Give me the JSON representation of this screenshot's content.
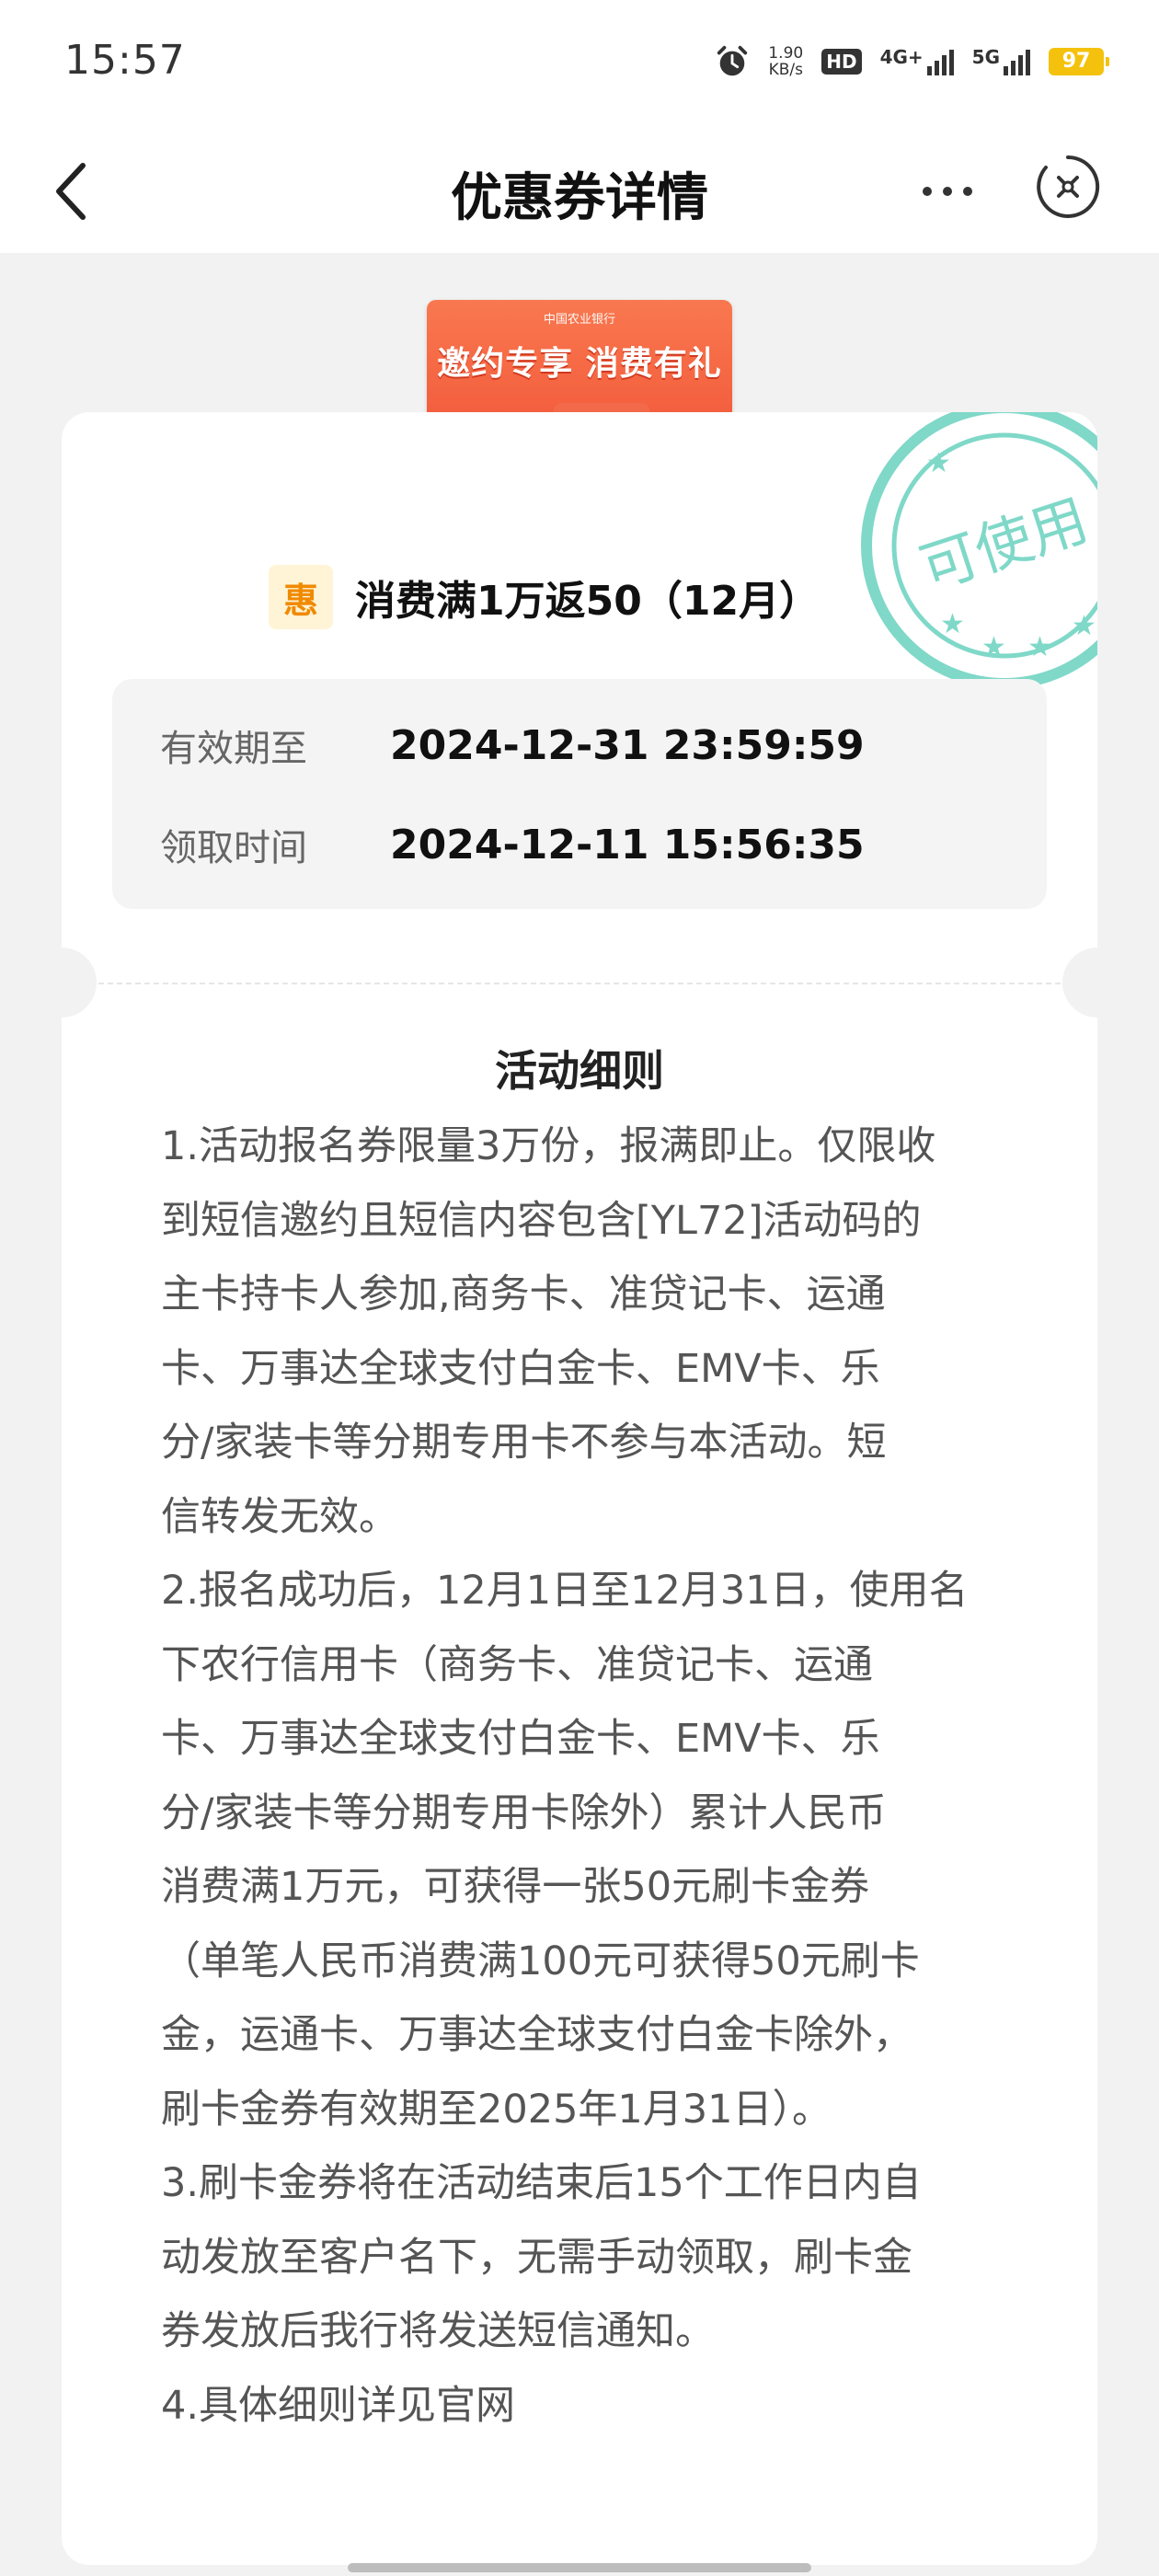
{
  "status_bar": {
    "time": "15:57",
    "net_speed_value": "1.90",
    "net_speed_unit": "KB/s",
    "hd_label": "HD",
    "network_4g": "4G+",
    "network_5g": "5G",
    "battery": "97",
    "battery_color": "#f4c20d"
  },
  "nav": {
    "title": "优惠券详情",
    "icons": [
      "back-arrow-icon",
      "more-dots-icon",
      "close-circle-icon"
    ]
  },
  "banner": {
    "title": "邀约专享 消费有礼",
    "bank_name": "中国农业银行"
  },
  "stamp": {
    "text": "可使用",
    "color": "#7fd8c8"
  },
  "coupon": {
    "badge": "惠",
    "title": "消费满1万返50（12月）"
  },
  "info": {
    "valid_until_label": "有效期至",
    "valid_until_value": "2024-12-31 23:59:59",
    "received_label": "领取时间",
    "received_value": "2024-12-11 15:56:35"
  },
  "rules": {
    "title": "活动细则",
    "lines": [
      "1.活动报名券限量3万份，报满即止。仅限收",
      "到短信邀约且短信内容包含[YL72]活动码的",
      "主卡持卡人参加,商务卡、准贷记卡、运通",
      "卡、万事达全球支付白金卡、EMV卡、乐",
      "分/家装卡等分期专用卡不参与本活动。短",
      "信转发无效。",
      "2.报名成功后，12月1日至12月31日，使用名",
      "下农行信用卡（商务卡、准贷记卡、运通",
      "卡、万事达全球支付白金卡、EMV卡、乐",
      "分/家装卡等分期专用卡除外）累计人民币",
      "消费满1万元，可获得一张50元刷卡金券",
      "（单笔人民币消费满100元可获得50元刷卡",
      "金，运通卡、万事达全球支付白金卡除外，",
      "刷卡金券有效期至2025年1月31日）。",
      "3.刷卡金券将在活动结束后15个工作日内自",
      "动发放至客户名下，无需手动领取，刷卡金",
      "券发放后我行将发送短信通知。",
      "4.具体细则详见官网"
    ]
  }
}
